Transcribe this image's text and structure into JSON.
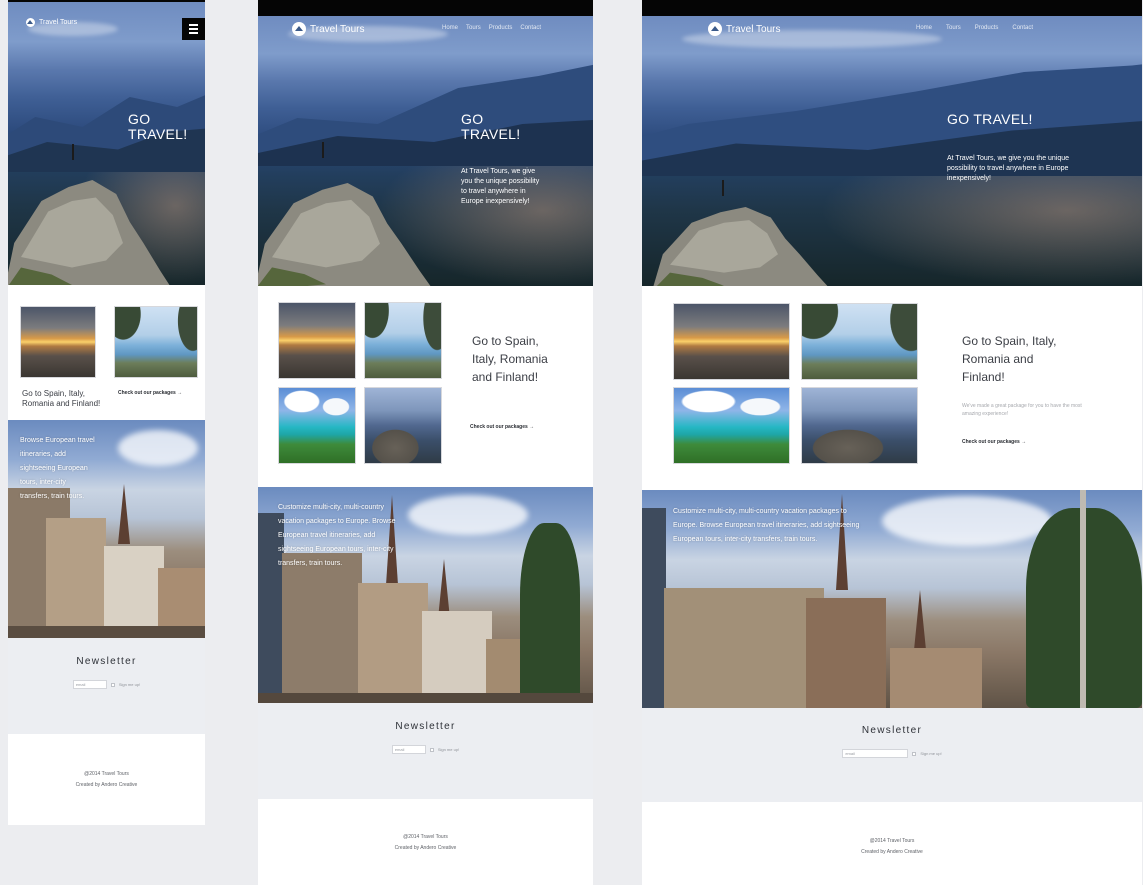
{
  "brand": {
    "name": "Travel Tours"
  },
  "nav": [
    "Home",
    "Tours",
    "Products",
    "Contact"
  ],
  "hero": {
    "title": "GO TRAVEL!",
    "text": "At Travel Tours, we give you the unique possibility to travel anywhere in Europe inexpensively!"
  },
  "promo": {
    "heading": "Go to Spain, Italy, Romania and Finland!",
    "subtext": "We've made a great package for you to have the most amazing experience!",
    "link": "Check out our packages →"
  },
  "feature": {
    "mobile_text": "Browse European travel itineraries, add sightseeing European tours, inter-city transfers, train tours.",
    "text": "Customize multi-city, multi-country vacation packages to Europe. Browse European travel itineraries, add sightseeing European tours, inter-city transfers, train tours."
  },
  "newsletter": {
    "title": "Newsletter",
    "placeholder": "email",
    "checkbox_label": "Sign me up!"
  },
  "footer": {
    "copyright": "@2014 Travel Tours",
    "credit": "Created by Andero Creative"
  },
  "icons": {
    "menu": "hamburger-icon",
    "logo": "globe-logo-icon",
    "arrow": "arrow-right-icon"
  },
  "colors": {
    "background": "#ecedf0",
    "topbar": "#050505",
    "text_dark": "#3b3e45",
    "newsletter_bg": "#eceef2"
  }
}
